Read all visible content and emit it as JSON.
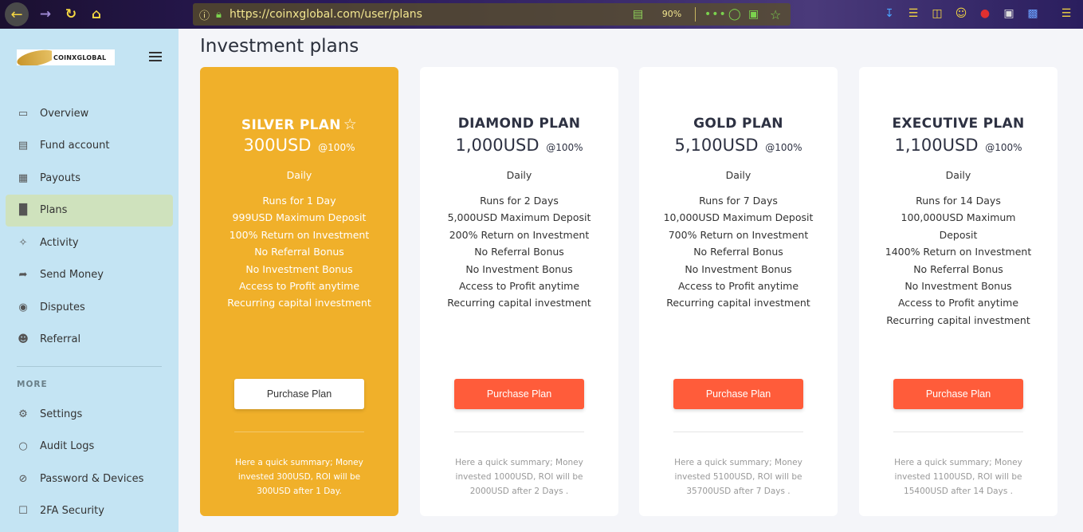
{
  "browser": {
    "url": "https://coinxglobal.com/user/plans",
    "zoom": "90%"
  },
  "sidebar": {
    "logo_text": "COINXGLOBAL",
    "items": [
      {
        "label": "Overview",
        "icon": "monitor-icon"
      },
      {
        "label": "Fund account",
        "icon": "wallet-icon"
      },
      {
        "label": "Payouts",
        "icon": "calendar-icon"
      },
      {
        "label": "Plans",
        "icon": "bar-chart-icon",
        "active": true
      },
      {
        "label": "Activity",
        "icon": "network-icon"
      },
      {
        "label": "Send Money",
        "icon": "share-icon"
      },
      {
        "label": "Disputes",
        "icon": "support-icon"
      },
      {
        "label": "Referral",
        "icon": "user-icon"
      }
    ],
    "more_label": "MORE",
    "more_items": [
      {
        "label": "Settings",
        "icon": "settings-icon"
      },
      {
        "label": "Audit Logs",
        "icon": "chat-icon"
      },
      {
        "label": "Password & Devices",
        "icon": "eye-off-icon"
      },
      {
        "label": "2FA Security",
        "icon": "lock-icon"
      }
    ]
  },
  "page": {
    "title": "Investment plans"
  },
  "plans": [
    {
      "name": "SILVER PLAN",
      "price": "300USD",
      "rate": "@100%",
      "frequency": "Daily",
      "features": [
        "Runs for 1 Day",
        "999USD Maximum Deposit",
        "100% Return on Investment",
        "No Referral Bonus",
        "No Investment Bonus",
        "Access to Profit anytime",
        "Recurring capital investment"
      ],
      "button": "Purchase Plan",
      "summary": "Here a quick summary; Money invested 300USD, ROI will be 300USD after 1 Day."
    },
    {
      "name": "DIAMOND PLAN",
      "price": "1,000USD",
      "rate": "@100%",
      "frequency": "Daily",
      "features": [
        "Runs for 2 Days",
        "5,000USD Maximum Deposit",
        "200% Return on Investment",
        "No Referral Bonus",
        "No Investment Bonus",
        "Access to Profit anytime",
        "Recurring capital investment"
      ],
      "button": "Purchase Plan",
      "summary": "Here a quick summary; Money invested 1000USD, ROI will be 2000USD after 2 Days ."
    },
    {
      "name": "GOLD PLAN",
      "price": "5,100USD",
      "rate": "@100%",
      "frequency": "Daily",
      "features": [
        "Runs for 7 Days",
        "10,000USD Maximum Deposit",
        "700% Return on Investment",
        "No Referral Bonus",
        "No Investment Bonus",
        "Access to Profit anytime",
        "Recurring capital investment"
      ],
      "button": "Purchase Plan",
      "summary": "Here a quick summary; Money invested 5100USD, ROI will be 35700USD after 7 Days ."
    },
    {
      "name": "EXECUTIVE PLAN",
      "price": "1,100USD",
      "rate": "@100%",
      "frequency": "Daily",
      "features": [
        "Runs for 14 Days",
        "100,000USD Maximum Deposit",
        "1400% Return on Investment",
        "No Referral Bonus",
        "No Investment Bonus",
        "Access to Profit anytime",
        "Recurring capital investment"
      ],
      "button": "Purchase Plan",
      "summary": "Here a quick summary; Money invested 1100USD, ROI will be 15400USD after 14 Days ."
    }
  ]
}
